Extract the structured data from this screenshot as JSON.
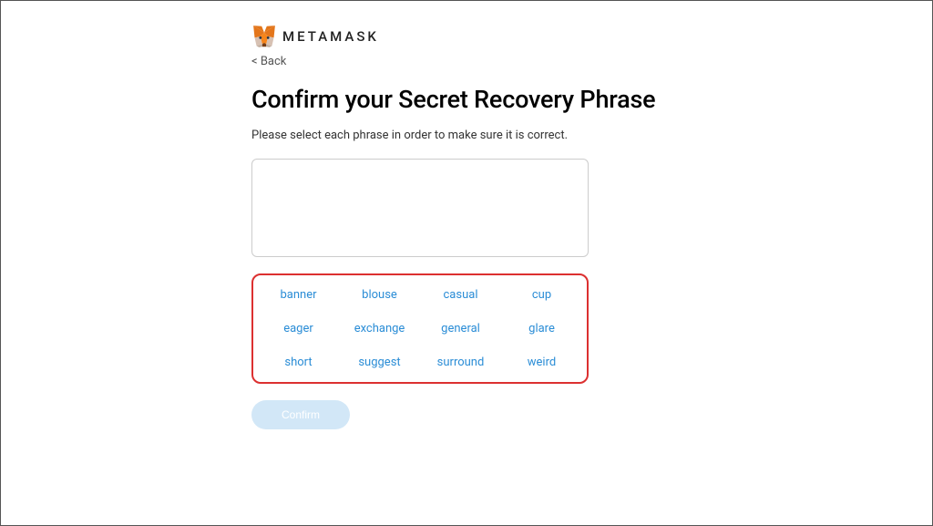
{
  "brand": "METAMASK",
  "back_label": "< Back",
  "title": "Confirm your Secret Recovery Phrase",
  "instruction": "Please select each phrase in order to make sure it is correct.",
  "words": {
    "w0": "banner",
    "w1": "blouse",
    "w2": "casual",
    "w3": "cup",
    "w4": "eager",
    "w5": "exchange",
    "w6": "general",
    "w7": "glare",
    "w8": "short",
    "w9": "suggest",
    "w10": "surround",
    "w11": "weird"
  },
  "confirm_label": "Confirm"
}
